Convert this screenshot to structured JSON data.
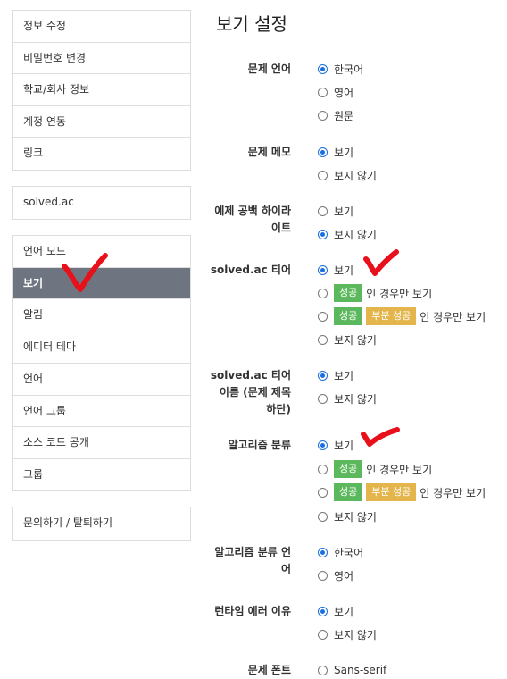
{
  "sidebar": {
    "group1": [
      "정보 수정",
      "비밀번호 변경",
      "학교/회사 정보",
      "계정 연동",
      "링크"
    ],
    "group2": [
      "solved.ac"
    ],
    "group3": [
      "언어 모드",
      "보기",
      "알림",
      "에디터 테마"
    ],
    "group4": [
      "언어",
      "언어 그룹",
      "소스 코드 공개",
      "그룹"
    ],
    "group5": [
      "문의하기 / 탈퇴하기"
    ],
    "active": "보기"
  },
  "page": {
    "title": "보기 설정"
  },
  "settings": {
    "problem_language": {
      "label": "문제 언어",
      "options": [
        "한국어",
        "영어",
        "원문"
      ],
      "selected": "한국어"
    },
    "problem_memo": {
      "label": "문제 메모",
      "options": [
        "보기",
        "보지 않기"
      ],
      "selected": "보기"
    },
    "example_whitespace": {
      "label_line1": "예제 공백 하이라",
      "label_line2": "이트",
      "options": [
        "보기",
        "보지 않기"
      ],
      "selected": "보지 않기"
    },
    "solved_tier": {
      "label": "solved.ac 티어",
      "opt_show": "보기",
      "opt_hide": "보지 않기",
      "badge_success": "성공",
      "badge_partial": "부분 성공",
      "suffix": "인 경우만 보기",
      "selected": "보기"
    },
    "solved_tier_name": {
      "label_line1": "solved.ac 티어",
      "label_line2": "이름 (문제 제목",
      "label_line3": "하단)",
      "options": [
        "보기",
        "보지 않기"
      ],
      "selected": "보기"
    },
    "algorithm_tags": {
      "label": "알고리즘 분류",
      "opt_show": "보기",
      "opt_hide": "보지 않기",
      "badge_success": "성공",
      "badge_partial": "부분 성공",
      "suffix": "인 경우만 보기",
      "selected": "보기"
    },
    "algorithm_tag_language": {
      "label_line1": "알고리즘 분류 언",
      "label_line2": "어",
      "options": [
        "한국어",
        "영어"
      ],
      "selected": "한국어"
    },
    "runtime_error_reason": {
      "label": "런타임 에러 이유",
      "options": [
        "보기",
        "보지 않기"
      ],
      "selected": "보기"
    },
    "problem_font": {
      "label": "문제 폰트",
      "options": [
        "Sans-serif"
      ]
    }
  },
  "colors": {
    "active_bg": "#6e7581",
    "radio_on": "#1a6fe0",
    "badge_success": "#5cb85c",
    "badge_partial": "#e3b54b",
    "annotation": "#e8101a"
  },
  "annotations": [
    "checkmark-icon",
    "checkmark-icon",
    "checkmark-icon"
  ]
}
